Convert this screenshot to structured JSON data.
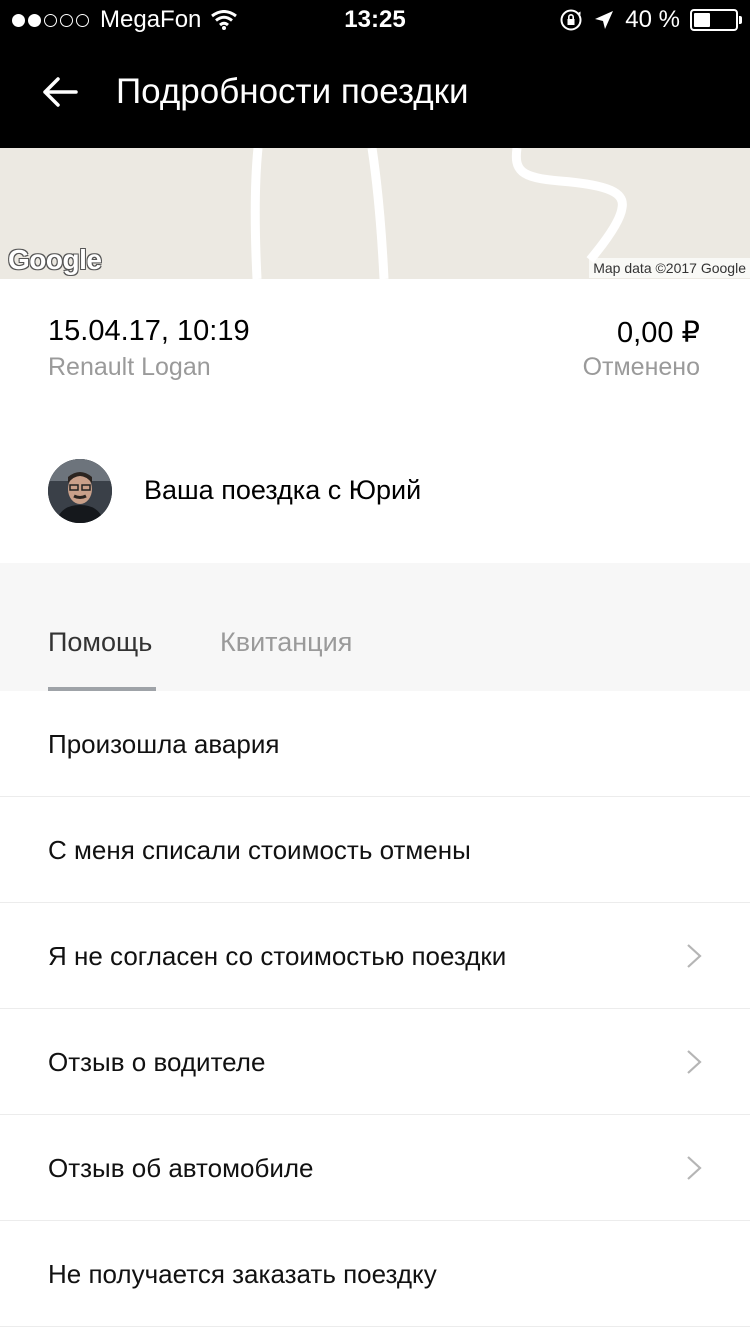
{
  "status_bar": {
    "carrier": "MegaFon",
    "time": "13:25",
    "battery_percent": "40 %",
    "battery_level": 0.4,
    "signal_bars_filled": 2,
    "signal_bars_total": 5,
    "icons": [
      "wifi-icon",
      "rotation-lock-icon",
      "location-arrow-icon",
      "battery-icon"
    ]
  },
  "header": {
    "title": "Подробности поездки",
    "back_icon": "arrow-left-icon"
  },
  "map": {
    "logo": "Google",
    "attribution": "Map data ©2017 Google",
    "background_color": "#ece9e2",
    "road_color": "#ffffff"
  },
  "trip": {
    "datetime": "15.04.17, 10:19",
    "car": "Renault Logan",
    "price": "0,00 ₽",
    "status": "Отменено"
  },
  "driver": {
    "text": "Ваша поездка с Юрий"
  },
  "tabs": [
    {
      "label": "Помощь",
      "active": true
    },
    {
      "label": "Квитанция",
      "active": false
    }
  ],
  "help_items": [
    {
      "label": "Произошла авария",
      "has_chevron": false
    },
    {
      "label": "С меня списали стоимость отмены",
      "has_chevron": false
    },
    {
      "label": "Я не согласен со стоимостью поездки",
      "has_chevron": true
    },
    {
      "label": "Отзыв о водителе",
      "has_chevron": true
    },
    {
      "label": "Отзыв об автомобиле",
      "has_chevron": true
    },
    {
      "label": "Не получается заказать поездку",
      "has_chevron": false
    }
  ],
  "colors": {
    "header_bg": "#000000",
    "secondary_text": "#9a9a9a",
    "tab_bar_bg": "#f7f7f7",
    "tab_indicator": "#9fa3a8"
  }
}
